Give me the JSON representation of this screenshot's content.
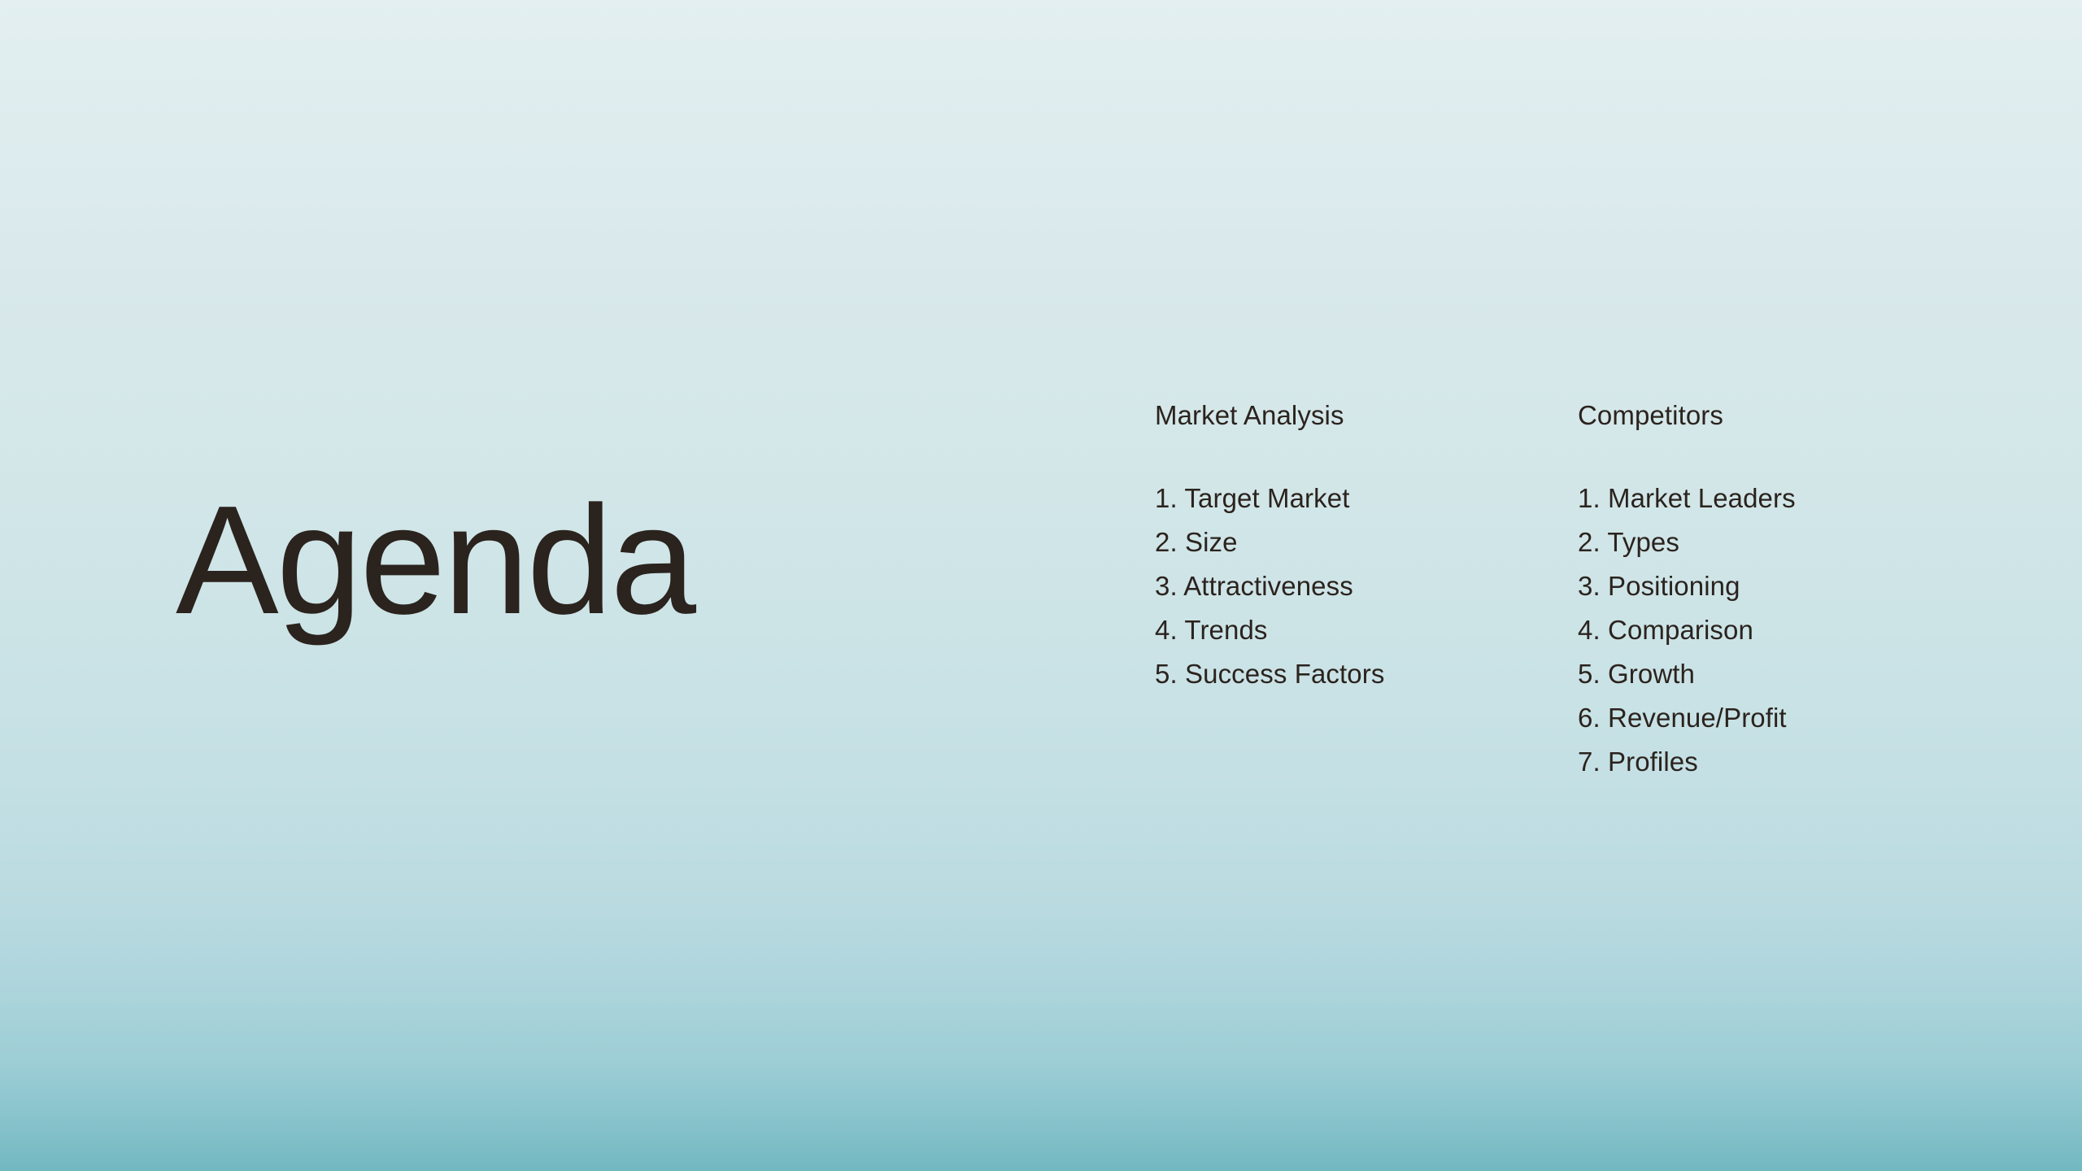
{
  "slide": {
    "title": "Agenda",
    "background": {
      "gradient_from": "#e3eff1",
      "gradient_to": "#72b8c1",
      "direction": "top-to-bottom"
    },
    "text_color": "#2b231e"
  },
  "columns": [
    {
      "heading": "Market Analysis",
      "items": [
        {
          "number": "1.",
          "label": "Target Market"
        },
        {
          "number": "2.",
          "label": "Size"
        },
        {
          "number": "3.",
          "label": "Attractiveness"
        },
        {
          "number": "4.",
          "label": "Trends"
        },
        {
          "number": "5.",
          "label": "Success Factors"
        }
      ]
    },
    {
      "heading": "Competitors",
      "items": [
        {
          "number": "1.",
          "label": "Market Leaders"
        },
        {
          "number": "2.",
          "label": "Types"
        },
        {
          "number": "3.",
          "label": "Positioning"
        },
        {
          "number": "4.",
          "label": "Comparison"
        },
        {
          "number": "5.",
          "label": "Growth"
        },
        {
          "number": "6.",
          "label": "Revenue/Profit"
        },
        {
          "number": "7.",
          "label": "Profiles"
        }
      ]
    }
  ]
}
